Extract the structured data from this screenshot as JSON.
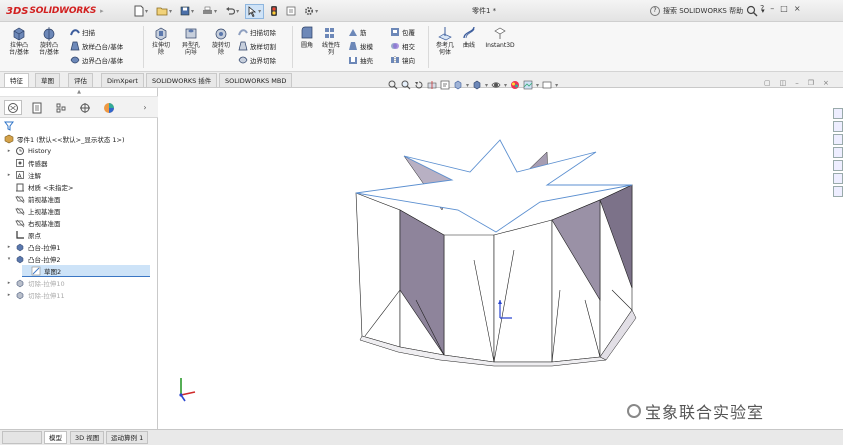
{
  "app": {
    "logo_prefix": "3DS",
    "logo_text": "SOLIDWORKS"
  },
  "document_title": "零件1 *",
  "search": {
    "label": "搜索 SOLIDWORKS 帮助"
  },
  "window_controls": {
    "help": "?",
    "minimize": "–",
    "restore": "□",
    "close": "×"
  },
  "ribbon": {
    "extrude_boss": "拉伸凸\n台/基体",
    "revolve_boss": "旋转凸\n台/基体",
    "sweep": "扫描",
    "loft_boss": "放样凸台/基体",
    "boundary_boss": "边界凸台/基体",
    "extrude_cut": "拉伸切\n除",
    "hole_wizard": "异型孔\n向导",
    "revolve_cut": "旋转切\n除",
    "swept_cut": "扫描切除",
    "lofted_cut": "放样切割",
    "boundary_cut": "边界切除",
    "fillet": "圆角",
    "linear_pattern": "线性阵\n列",
    "rib": "筋",
    "draft": "拔模",
    "shell": "抽壳",
    "wrap": "包覆",
    "intersect": "相交",
    "mirror": "镜向",
    "reference_geometry": "参考几\n何体",
    "curves": "曲线",
    "instant3d": "Instant3D"
  },
  "cm_tabs": [
    "特征",
    "草图",
    "评估",
    "DimXpert",
    "SOLIDWORKS 插件",
    "SOLIDWORKS MBD"
  ],
  "cm_active": "特征",
  "tree": {
    "root": "零件1 (默认<<默认>_显示状态 1>)",
    "items": [
      {
        "label": "History",
        "indent": 1,
        "expand": "▸"
      },
      {
        "label": "传感器",
        "indent": 1,
        "expand": ""
      },
      {
        "label": "注解",
        "indent": 1,
        "expand": "▸"
      },
      {
        "label": "材质 <未指定>",
        "indent": 1,
        "expand": ""
      },
      {
        "label": "前视基准面",
        "indent": 1,
        "expand": ""
      },
      {
        "label": "上视基准面",
        "indent": 1,
        "expand": ""
      },
      {
        "label": "右视基准面",
        "indent": 1,
        "expand": ""
      },
      {
        "label": "原点",
        "indent": 1,
        "expand": ""
      },
      {
        "label": "凸台-拉伸1",
        "indent": 1,
        "expand": "▸"
      },
      {
        "label": "凸台-拉伸2",
        "indent": 1,
        "expand": "▾"
      },
      {
        "label": "草图2",
        "indent": 2,
        "expand": "",
        "selected": true
      },
      {
        "label": "切除-拉伸10",
        "indent": 1,
        "expand": "▸",
        "suppressed": true
      },
      {
        "label": "切除-拉伸11",
        "indent": 1,
        "expand": "▸",
        "suppressed": true
      }
    ]
  },
  "bottom_tabs": [
    "模型",
    "3D 视图",
    "运动算例 1"
  ],
  "bottom_active": "模型",
  "watermark": "宝象联合实验室",
  "colors": {
    "brand": "#d21f1f",
    "model_face": "#d6d1dc",
    "model_dark": "#8e849b",
    "edge": "#1f1f1f",
    "silhouette": "#5b8fd0"
  }
}
